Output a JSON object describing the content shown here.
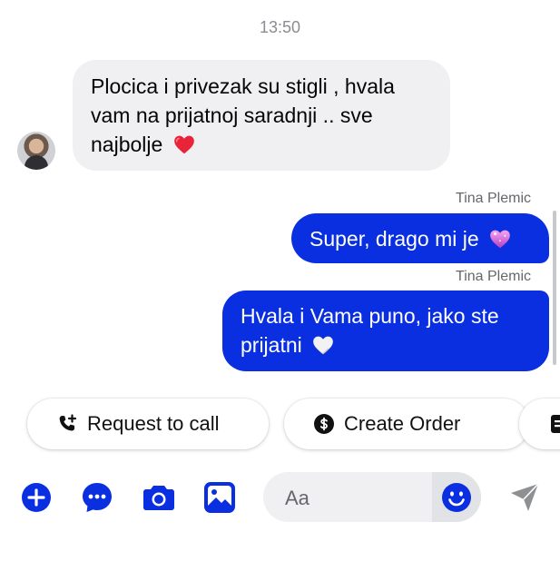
{
  "conversation": {
    "timestamp": "13:50",
    "incoming": {
      "lines": [
        "Plocica i privezak su stigli , hvala",
        "vam na prijatnoj saradnji .. sve",
        "najbolje"
      ],
      "emoji": "red-heart"
    },
    "outgoing": [
      {
        "sender": "Tina Plemic",
        "text": "Super, drago mi je",
        "emoji": "purple-heart"
      },
      {
        "sender": "Tina Plemic",
        "lines": [
          "Hvala i Vama puno, jako ste",
          "prijatni"
        ],
        "emoji": "white-heart"
      }
    ]
  },
  "quick_actions": [
    {
      "label": "Request to call",
      "icon": "phone-plus-icon"
    },
    {
      "label": "Create Order",
      "icon": "dollar-circle-icon"
    },
    {
      "label": "",
      "icon": "order-list-icon"
    }
  ],
  "composer": {
    "placeholder": "Aa",
    "tools": [
      "add-icon",
      "more-icon",
      "camera-icon",
      "gallery-icon"
    ],
    "send_icon": "send-icon"
  },
  "colors": {
    "accent": "#0a2fe0",
    "incoming_bubble": "#f0f0f3",
    "muted_text": "#8a8d91"
  }
}
